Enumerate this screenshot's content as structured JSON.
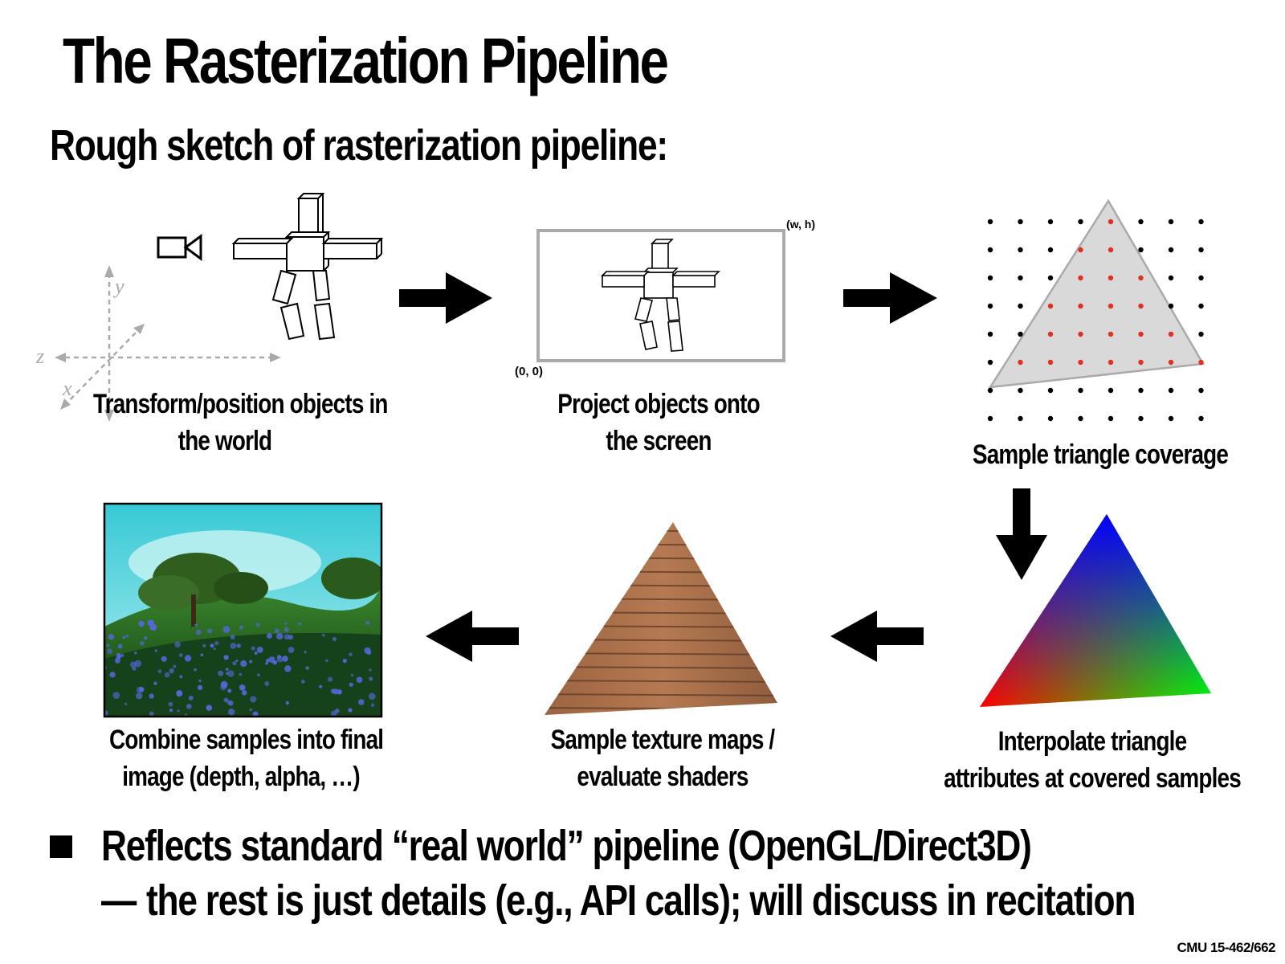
{
  "title": "The Rasterization Pipeline",
  "subtitle": "Rough sketch of rasterization pipeline:",
  "stages": [
    {
      "caption_line1": "Transform/position objects in",
      "caption_line2": "the world"
    },
    {
      "caption_line1": "Project objects onto",
      "caption_line2": "the screen"
    },
    {
      "caption_line1": "Sample triangle coverage",
      "caption_line2": ""
    },
    {
      "caption_line1": "Interpolate triangle",
      "caption_line2": "attributes at covered samples"
    },
    {
      "caption_line1": "Sample texture maps /",
      "caption_line2": "evaluate shaders"
    },
    {
      "caption_line1": "Combine samples into final",
      "caption_line2": "image (depth, alpha, …)"
    }
  ],
  "axes": {
    "x": "x",
    "y": "y",
    "z": "z"
  },
  "screen_labels": {
    "origin": "(0, 0)",
    "corner": "(w, h)"
  },
  "bullets": [
    {
      "marker": "■",
      "text": "Reflects standard “real world”  pipeline (OpenGL/Direct3D)"
    },
    {
      "marker": "—",
      "text": "the rest is just details (e.g., API calls); will discuss in recitation"
    }
  ],
  "footer": "CMU 15-462/662",
  "colors": {
    "sample_covered": "#e0301e",
    "sample_uncovered": "#000000",
    "triangle_fill": "#d9d9d9",
    "wood": "#a86e48"
  },
  "icons": [
    "camera-icon",
    "arrow-right-icon",
    "arrow-down-icon",
    "arrow-left-icon"
  ]
}
